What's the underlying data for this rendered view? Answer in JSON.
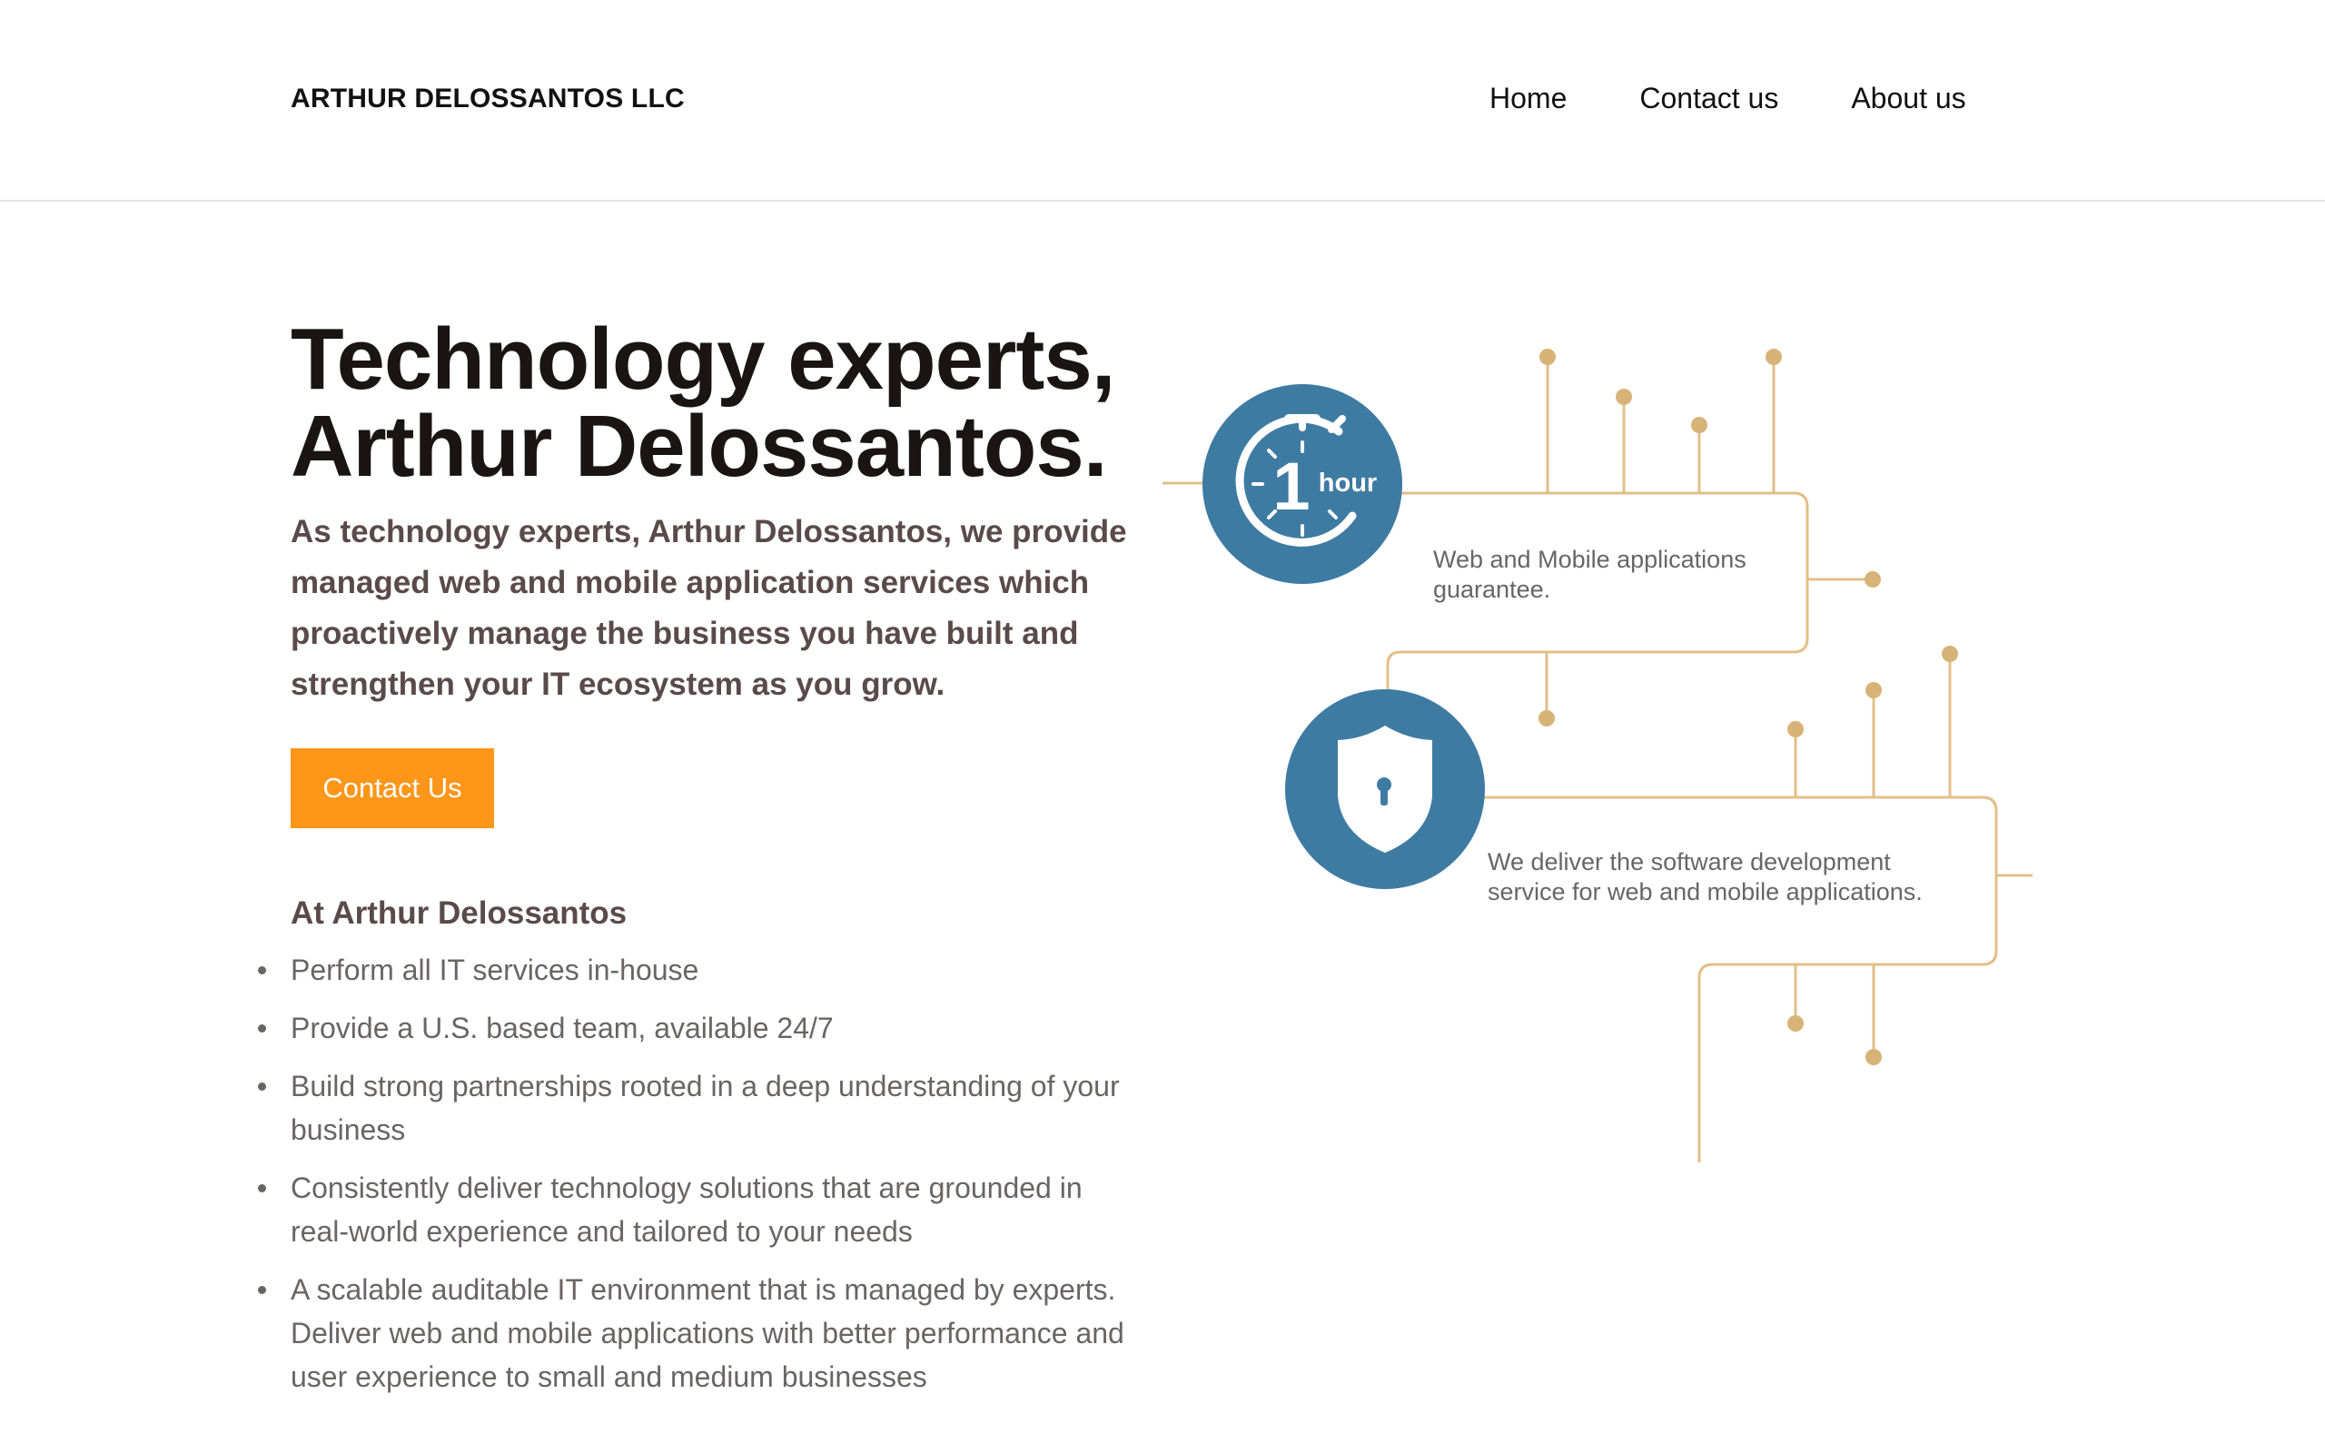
{
  "header": {
    "brand": "ARTHUR DELOSSANTOS LLC",
    "nav": [
      "Home",
      "Contact us",
      "About us"
    ]
  },
  "hero": {
    "title_line1": "Technology experts,",
    "title_line2": "Arthur Delossantos.",
    "subtitle": "As technology experts, Arthur Delossantos, we provide managed web and mobile application services which proactively manage the business you have built and strengthen your IT ecosystem as you grow.",
    "cta_label": "Contact Us"
  },
  "features": {
    "title": "At Arthur Delossantos",
    "items": [
      "Perform all IT services in-house",
      "Provide a U.S. based team, available 24/7",
      "Build strong partnerships rooted in a deep understanding of your business",
      "Consistently deliver technology solutions that are grounded in real-world experience and tailored to your needs",
      "A scalable auditable IT environment that is managed by experts. Deliver web and mobile applications with better performance and user experience to small and medium businesses"
    ]
  },
  "graphic": {
    "badge1_number": "1",
    "badge1_unit": "hour",
    "badge1_text_line1": "Web and Mobile applications",
    "badge1_text_line2": "guarantee.",
    "badge2_text_line1": "We deliver the software development",
    "badge2_text_line2": "service for web and mobile applications.",
    "badge1_icon": "stopwatch-icon",
    "badge2_icon": "shield-lock-icon"
  },
  "colors": {
    "accent": "#fd9619",
    "badge": "#3e7ba2",
    "circuit": "#e2bf88",
    "heading": "#1a1414",
    "subheading": "#5a4a4a",
    "body_text": "#6b6464"
  }
}
